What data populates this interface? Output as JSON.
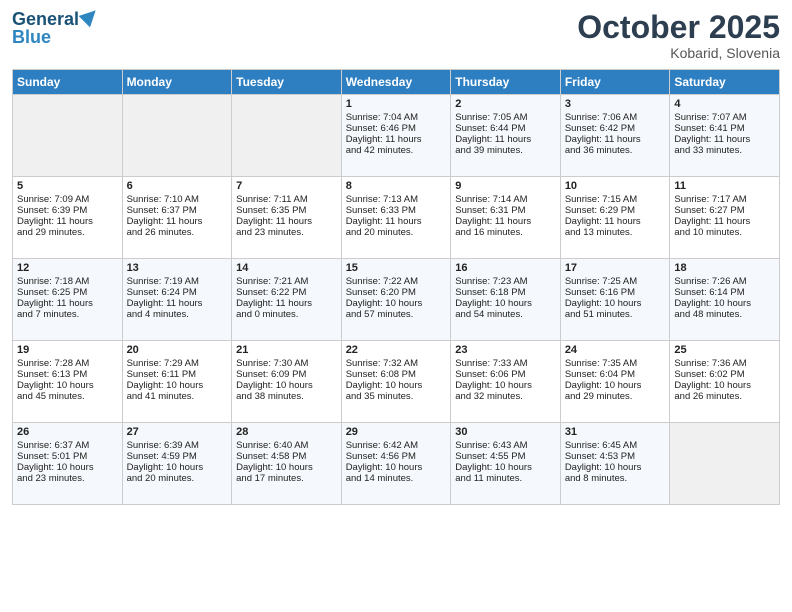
{
  "header": {
    "logo_line1": "General",
    "logo_line2": "Blue",
    "month": "October 2025",
    "location": "Kobarid, Slovenia"
  },
  "weekdays": [
    "Sunday",
    "Monday",
    "Tuesday",
    "Wednesday",
    "Thursday",
    "Friday",
    "Saturday"
  ],
  "weeks": [
    [
      {
        "day": "",
        "info": ""
      },
      {
        "day": "",
        "info": ""
      },
      {
        "day": "",
        "info": ""
      },
      {
        "day": "1",
        "info": "Sunrise: 7:04 AM\nSunset: 6:46 PM\nDaylight: 11 hours\nand 42 minutes."
      },
      {
        "day": "2",
        "info": "Sunrise: 7:05 AM\nSunset: 6:44 PM\nDaylight: 11 hours\nand 39 minutes."
      },
      {
        "day": "3",
        "info": "Sunrise: 7:06 AM\nSunset: 6:42 PM\nDaylight: 11 hours\nand 36 minutes."
      },
      {
        "day": "4",
        "info": "Sunrise: 7:07 AM\nSunset: 6:41 PM\nDaylight: 11 hours\nand 33 minutes."
      }
    ],
    [
      {
        "day": "5",
        "info": "Sunrise: 7:09 AM\nSunset: 6:39 PM\nDaylight: 11 hours\nand 29 minutes."
      },
      {
        "day": "6",
        "info": "Sunrise: 7:10 AM\nSunset: 6:37 PM\nDaylight: 11 hours\nand 26 minutes."
      },
      {
        "day": "7",
        "info": "Sunrise: 7:11 AM\nSunset: 6:35 PM\nDaylight: 11 hours\nand 23 minutes."
      },
      {
        "day": "8",
        "info": "Sunrise: 7:13 AM\nSunset: 6:33 PM\nDaylight: 11 hours\nand 20 minutes."
      },
      {
        "day": "9",
        "info": "Sunrise: 7:14 AM\nSunset: 6:31 PM\nDaylight: 11 hours\nand 16 minutes."
      },
      {
        "day": "10",
        "info": "Sunrise: 7:15 AM\nSunset: 6:29 PM\nDaylight: 11 hours\nand 13 minutes."
      },
      {
        "day": "11",
        "info": "Sunrise: 7:17 AM\nSunset: 6:27 PM\nDaylight: 11 hours\nand 10 minutes."
      }
    ],
    [
      {
        "day": "12",
        "info": "Sunrise: 7:18 AM\nSunset: 6:25 PM\nDaylight: 11 hours\nand 7 minutes."
      },
      {
        "day": "13",
        "info": "Sunrise: 7:19 AM\nSunset: 6:24 PM\nDaylight: 11 hours\nand 4 minutes."
      },
      {
        "day": "14",
        "info": "Sunrise: 7:21 AM\nSunset: 6:22 PM\nDaylight: 11 hours\nand 0 minutes."
      },
      {
        "day": "15",
        "info": "Sunrise: 7:22 AM\nSunset: 6:20 PM\nDaylight: 10 hours\nand 57 minutes."
      },
      {
        "day": "16",
        "info": "Sunrise: 7:23 AM\nSunset: 6:18 PM\nDaylight: 10 hours\nand 54 minutes."
      },
      {
        "day": "17",
        "info": "Sunrise: 7:25 AM\nSunset: 6:16 PM\nDaylight: 10 hours\nand 51 minutes."
      },
      {
        "day": "18",
        "info": "Sunrise: 7:26 AM\nSunset: 6:14 PM\nDaylight: 10 hours\nand 48 minutes."
      }
    ],
    [
      {
        "day": "19",
        "info": "Sunrise: 7:28 AM\nSunset: 6:13 PM\nDaylight: 10 hours\nand 45 minutes."
      },
      {
        "day": "20",
        "info": "Sunrise: 7:29 AM\nSunset: 6:11 PM\nDaylight: 10 hours\nand 41 minutes."
      },
      {
        "day": "21",
        "info": "Sunrise: 7:30 AM\nSunset: 6:09 PM\nDaylight: 10 hours\nand 38 minutes."
      },
      {
        "day": "22",
        "info": "Sunrise: 7:32 AM\nSunset: 6:08 PM\nDaylight: 10 hours\nand 35 minutes."
      },
      {
        "day": "23",
        "info": "Sunrise: 7:33 AM\nSunset: 6:06 PM\nDaylight: 10 hours\nand 32 minutes."
      },
      {
        "day": "24",
        "info": "Sunrise: 7:35 AM\nSunset: 6:04 PM\nDaylight: 10 hours\nand 29 minutes."
      },
      {
        "day": "25",
        "info": "Sunrise: 7:36 AM\nSunset: 6:02 PM\nDaylight: 10 hours\nand 26 minutes."
      }
    ],
    [
      {
        "day": "26",
        "info": "Sunrise: 6:37 AM\nSunset: 5:01 PM\nDaylight: 10 hours\nand 23 minutes."
      },
      {
        "day": "27",
        "info": "Sunrise: 6:39 AM\nSunset: 4:59 PM\nDaylight: 10 hours\nand 20 minutes."
      },
      {
        "day": "28",
        "info": "Sunrise: 6:40 AM\nSunset: 4:58 PM\nDaylight: 10 hours\nand 17 minutes."
      },
      {
        "day": "29",
        "info": "Sunrise: 6:42 AM\nSunset: 4:56 PM\nDaylight: 10 hours\nand 14 minutes."
      },
      {
        "day": "30",
        "info": "Sunrise: 6:43 AM\nSunset: 4:55 PM\nDaylight: 10 hours\nand 11 minutes."
      },
      {
        "day": "31",
        "info": "Sunrise: 6:45 AM\nSunset: 4:53 PM\nDaylight: 10 hours\nand 8 minutes."
      },
      {
        "day": "",
        "info": ""
      }
    ]
  ]
}
